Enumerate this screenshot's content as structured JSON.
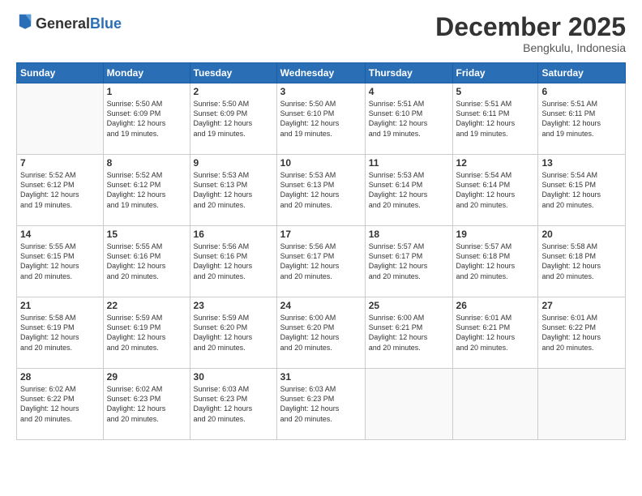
{
  "logo": {
    "general": "General",
    "blue": "Blue"
  },
  "header": {
    "month": "December 2025",
    "location": "Bengkulu, Indonesia"
  },
  "weekdays": [
    "Sunday",
    "Monday",
    "Tuesday",
    "Wednesday",
    "Thursday",
    "Friday",
    "Saturday"
  ],
  "weeks": [
    [
      {
        "day": "",
        "info": ""
      },
      {
        "day": "1",
        "info": "Sunrise: 5:50 AM\nSunset: 6:09 PM\nDaylight: 12 hours\nand 19 minutes."
      },
      {
        "day": "2",
        "info": "Sunrise: 5:50 AM\nSunset: 6:09 PM\nDaylight: 12 hours\nand 19 minutes."
      },
      {
        "day": "3",
        "info": "Sunrise: 5:50 AM\nSunset: 6:10 PM\nDaylight: 12 hours\nand 19 minutes."
      },
      {
        "day": "4",
        "info": "Sunrise: 5:51 AM\nSunset: 6:10 PM\nDaylight: 12 hours\nand 19 minutes."
      },
      {
        "day": "5",
        "info": "Sunrise: 5:51 AM\nSunset: 6:11 PM\nDaylight: 12 hours\nand 19 minutes."
      },
      {
        "day": "6",
        "info": "Sunrise: 5:51 AM\nSunset: 6:11 PM\nDaylight: 12 hours\nand 19 minutes."
      }
    ],
    [
      {
        "day": "7",
        "info": "Sunrise: 5:52 AM\nSunset: 6:12 PM\nDaylight: 12 hours\nand 19 minutes."
      },
      {
        "day": "8",
        "info": "Sunrise: 5:52 AM\nSunset: 6:12 PM\nDaylight: 12 hours\nand 19 minutes."
      },
      {
        "day": "9",
        "info": "Sunrise: 5:53 AM\nSunset: 6:13 PM\nDaylight: 12 hours\nand 20 minutes."
      },
      {
        "day": "10",
        "info": "Sunrise: 5:53 AM\nSunset: 6:13 PM\nDaylight: 12 hours\nand 20 minutes."
      },
      {
        "day": "11",
        "info": "Sunrise: 5:53 AM\nSunset: 6:14 PM\nDaylight: 12 hours\nand 20 minutes."
      },
      {
        "day": "12",
        "info": "Sunrise: 5:54 AM\nSunset: 6:14 PM\nDaylight: 12 hours\nand 20 minutes."
      },
      {
        "day": "13",
        "info": "Sunrise: 5:54 AM\nSunset: 6:15 PM\nDaylight: 12 hours\nand 20 minutes."
      }
    ],
    [
      {
        "day": "14",
        "info": "Sunrise: 5:55 AM\nSunset: 6:15 PM\nDaylight: 12 hours\nand 20 minutes."
      },
      {
        "day": "15",
        "info": "Sunrise: 5:55 AM\nSunset: 6:16 PM\nDaylight: 12 hours\nand 20 minutes."
      },
      {
        "day": "16",
        "info": "Sunrise: 5:56 AM\nSunset: 6:16 PM\nDaylight: 12 hours\nand 20 minutes."
      },
      {
        "day": "17",
        "info": "Sunrise: 5:56 AM\nSunset: 6:17 PM\nDaylight: 12 hours\nand 20 minutes."
      },
      {
        "day": "18",
        "info": "Sunrise: 5:57 AM\nSunset: 6:17 PM\nDaylight: 12 hours\nand 20 minutes."
      },
      {
        "day": "19",
        "info": "Sunrise: 5:57 AM\nSunset: 6:18 PM\nDaylight: 12 hours\nand 20 minutes."
      },
      {
        "day": "20",
        "info": "Sunrise: 5:58 AM\nSunset: 6:18 PM\nDaylight: 12 hours\nand 20 minutes."
      }
    ],
    [
      {
        "day": "21",
        "info": "Sunrise: 5:58 AM\nSunset: 6:19 PM\nDaylight: 12 hours\nand 20 minutes."
      },
      {
        "day": "22",
        "info": "Sunrise: 5:59 AM\nSunset: 6:19 PM\nDaylight: 12 hours\nand 20 minutes."
      },
      {
        "day": "23",
        "info": "Sunrise: 5:59 AM\nSunset: 6:20 PM\nDaylight: 12 hours\nand 20 minutes."
      },
      {
        "day": "24",
        "info": "Sunrise: 6:00 AM\nSunset: 6:20 PM\nDaylight: 12 hours\nand 20 minutes."
      },
      {
        "day": "25",
        "info": "Sunrise: 6:00 AM\nSunset: 6:21 PM\nDaylight: 12 hours\nand 20 minutes."
      },
      {
        "day": "26",
        "info": "Sunrise: 6:01 AM\nSunset: 6:21 PM\nDaylight: 12 hours\nand 20 minutes."
      },
      {
        "day": "27",
        "info": "Sunrise: 6:01 AM\nSunset: 6:22 PM\nDaylight: 12 hours\nand 20 minutes."
      }
    ],
    [
      {
        "day": "28",
        "info": "Sunrise: 6:02 AM\nSunset: 6:22 PM\nDaylight: 12 hours\nand 20 minutes."
      },
      {
        "day": "29",
        "info": "Sunrise: 6:02 AM\nSunset: 6:23 PM\nDaylight: 12 hours\nand 20 minutes."
      },
      {
        "day": "30",
        "info": "Sunrise: 6:03 AM\nSunset: 6:23 PM\nDaylight: 12 hours\nand 20 minutes."
      },
      {
        "day": "31",
        "info": "Sunrise: 6:03 AM\nSunset: 6:23 PM\nDaylight: 12 hours\nand 20 minutes."
      },
      {
        "day": "",
        "info": ""
      },
      {
        "day": "",
        "info": ""
      },
      {
        "day": "",
        "info": ""
      }
    ]
  ]
}
